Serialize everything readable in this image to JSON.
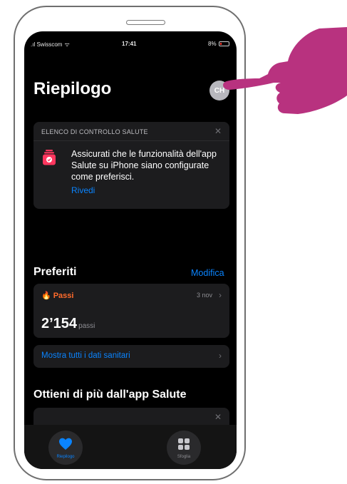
{
  "status_bar": {
    "carrier": "Swisscom",
    "time": "17:41",
    "battery": "8%"
  },
  "header": {
    "title": "Riepilogo",
    "avatar_initials": "CH"
  },
  "checklist": {
    "title": "ELENCO DI CONTROLLO SALUTE",
    "text": "Assicurati che le funzionalità dell'app Salute su iPhone siano configurate come preferisci.",
    "link": "Rivedi"
  },
  "favorites": {
    "title": "Preferiti",
    "edit": "Modifica",
    "steps": {
      "label": "Passi",
      "date": "3 nov",
      "value": "2’154",
      "unit": "passi"
    },
    "show_all": "Mostra tutti i dati sanitari"
  },
  "more": {
    "title": "Ottieni di più dall'app Salute"
  },
  "tabbar": {
    "summary": "Riepilogo",
    "browse": "Sfoglia"
  },
  "colors": {
    "accent": "#0a84ff",
    "steps": "#ff6b2c",
    "hand": "#b8327f"
  }
}
